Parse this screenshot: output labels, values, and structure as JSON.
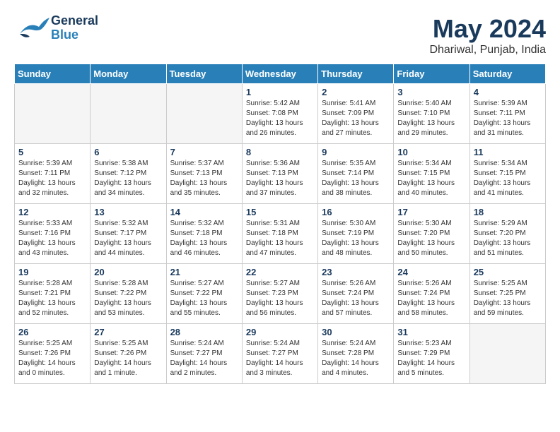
{
  "header": {
    "logo_general": "General",
    "logo_blue": "Blue",
    "month_title": "May 2024",
    "location": "Dhariwal, Punjab, India"
  },
  "days_of_week": [
    "Sunday",
    "Monday",
    "Tuesday",
    "Wednesday",
    "Thursday",
    "Friday",
    "Saturday"
  ],
  "weeks": [
    [
      {
        "day": "",
        "info": ""
      },
      {
        "day": "",
        "info": ""
      },
      {
        "day": "",
        "info": ""
      },
      {
        "day": "1",
        "info": "Sunrise: 5:42 AM\nSunset: 7:08 PM\nDaylight: 13 hours\nand 26 minutes."
      },
      {
        "day": "2",
        "info": "Sunrise: 5:41 AM\nSunset: 7:09 PM\nDaylight: 13 hours\nand 27 minutes."
      },
      {
        "day": "3",
        "info": "Sunrise: 5:40 AM\nSunset: 7:10 PM\nDaylight: 13 hours\nand 29 minutes."
      },
      {
        "day": "4",
        "info": "Sunrise: 5:39 AM\nSunset: 7:11 PM\nDaylight: 13 hours\nand 31 minutes."
      }
    ],
    [
      {
        "day": "5",
        "info": "Sunrise: 5:39 AM\nSunset: 7:11 PM\nDaylight: 13 hours\nand 32 minutes."
      },
      {
        "day": "6",
        "info": "Sunrise: 5:38 AM\nSunset: 7:12 PM\nDaylight: 13 hours\nand 34 minutes."
      },
      {
        "day": "7",
        "info": "Sunrise: 5:37 AM\nSunset: 7:13 PM\nDaylight: 13 hours\nand 35 minutes."
      },
      {
        "day": "8",
        "info": "Sunrise: 5:36 AM\nSunset: 7:13 PM\nDaylight: 13 hours\nand 37 minutes."
      },
      {
        "day": "9",
        "info": "Sunrise: 5:35 AM\nSunset: 7:14 PM\nDaylight: 13 hours\nand 38 minutes."
      },
      {
        "day": "10",
        "info": "Sunrise: 5:34 AM\nSunset: 7:15 PM\nDaylight: 13 hours\nand 40 minutes."
      },
      {
        "day": "11",
        "info": "Sunrise: 5:34 AM\nSunset: 7:15 PM\nDaylight: 13 hours\nand 41 minutes."
      }
    ],
    [
      {
        "day": "12",
        "info": "Sunrise: 5:33 AM\nSunset: 7:16 PM\nDaylight: 13 hours\nand 43 minutes."
      },
      {
        "day": "13",
        "info": "Sunrise: 5:32 AM\nSunset: 7:17 PM\nDaylight: 13 hours\nand 44 minutes."
      },
      {
        "day": "14",
        "info": "Sunrise: 5:32 AM\nSunset: 7:18 PM\nDaylight: 13 hours\nand 46 minutes."
      },
      {
        "day": "15",
        "info": "Sunrise: 5:31 AM\nSunset: 7:18 PM\nDaylight: 13 hours\nand 47 minutes."
      },
      {
        "day": "16",
        "info": "Sunrise: 5:30 AM\nSunset: 7:19 PM\nDaylight: 13 hours\nand 48 minutes."
      },
      {
        "day": "17",
        "info": "Sunrise: 5:30 AM\nSunset: 7:20 PM\nDaylight: 13 hours\nand 50 minutes."
      },
      {
        "day": "18",
        "info": "Sunrise: 5:29 AM\nSunset: 7:20 PM\nDaylight: 13 hours\nand 51 minutes."
      }
    ],
    [
      {
        "day": "19",
        "info": "Sunrise: 5:28 AM\nSunset: 7:21 PM\nDaylight: 13 hours\nand 52 minutes."
      },
      {
        "day": "20",
        "info": "Sunrise: 5:28 AM\nSunset: 7:22 PM\nDaylight: 13 hours\nand 53 minutes."
      },
      {
        "day": "21",
        "info": "Sunrise: 5:27 AM\nSunset: 7:22 PM\nDaylight: 13 hours\nand 55 minutes."
      },
      {
        "day": "22",
        "info": "Sunrise: 5:27 AM\nSunset: 7:23 PM\nDaylight: 13 hours\nand 56 minutes."
      },
      {
        "day": "23",
        "info": "Sunrise: 5:26 AM\nSunset: 7:24 PM\nDaylight: 13 hours\nand 57 minutes."
      },
      {
        "day": "24",
        "info": "Sunrise: 5:26 AM\nSunset: 7:24 PM\nDaylight: 13 hours\nand 58 minutes."
      },
      {
        "day": "25",
        "info": "Sunrise: 5:25 AM\nSunset: 7:25 PM\nDaylight: 13 hours\nand 59 minutes."
      }
    ],
    [
      {
        "day": "26",
        "info": "Sunrise: 5:25 AM\nSunset: 7:26 PM\nDaylight: 14 hours\nand 0 minutes."
      },
      {
        "day": "27",
        "info": "Sunrise: 5:25 AM\nSunset: 7:26 PM\nDaylight: 14 hours\nand 1 minute."
      },
      {
        "day": "28",
        "info": "Sunrise: 5:24 AM\nSunset: 7:27 PM\nDaylight: 14 hours\nand 2 minutes."
      },
      {
        "day": "29",
        "info": "Sunrise: 5:24 AM\nSunset: 7:27 PM\nDaylight: 14 hours\nand 3 minutes."
      },
      {
        "day": "30",
        "info": "Sunrise: 5:24 AM\nSunset: 7:28 PM\nDaylight: 14 hours\nand 4 minutes."
      },
      {
        "day": "31",
        "info": "Sunrise: 5:23 AM\nSunset: 7:29 PM\nDaylight: 14 hours\nand 5 minutes."
      },
      {
        "day": "",
        "info": ""
      }
    ]
  ]
}
